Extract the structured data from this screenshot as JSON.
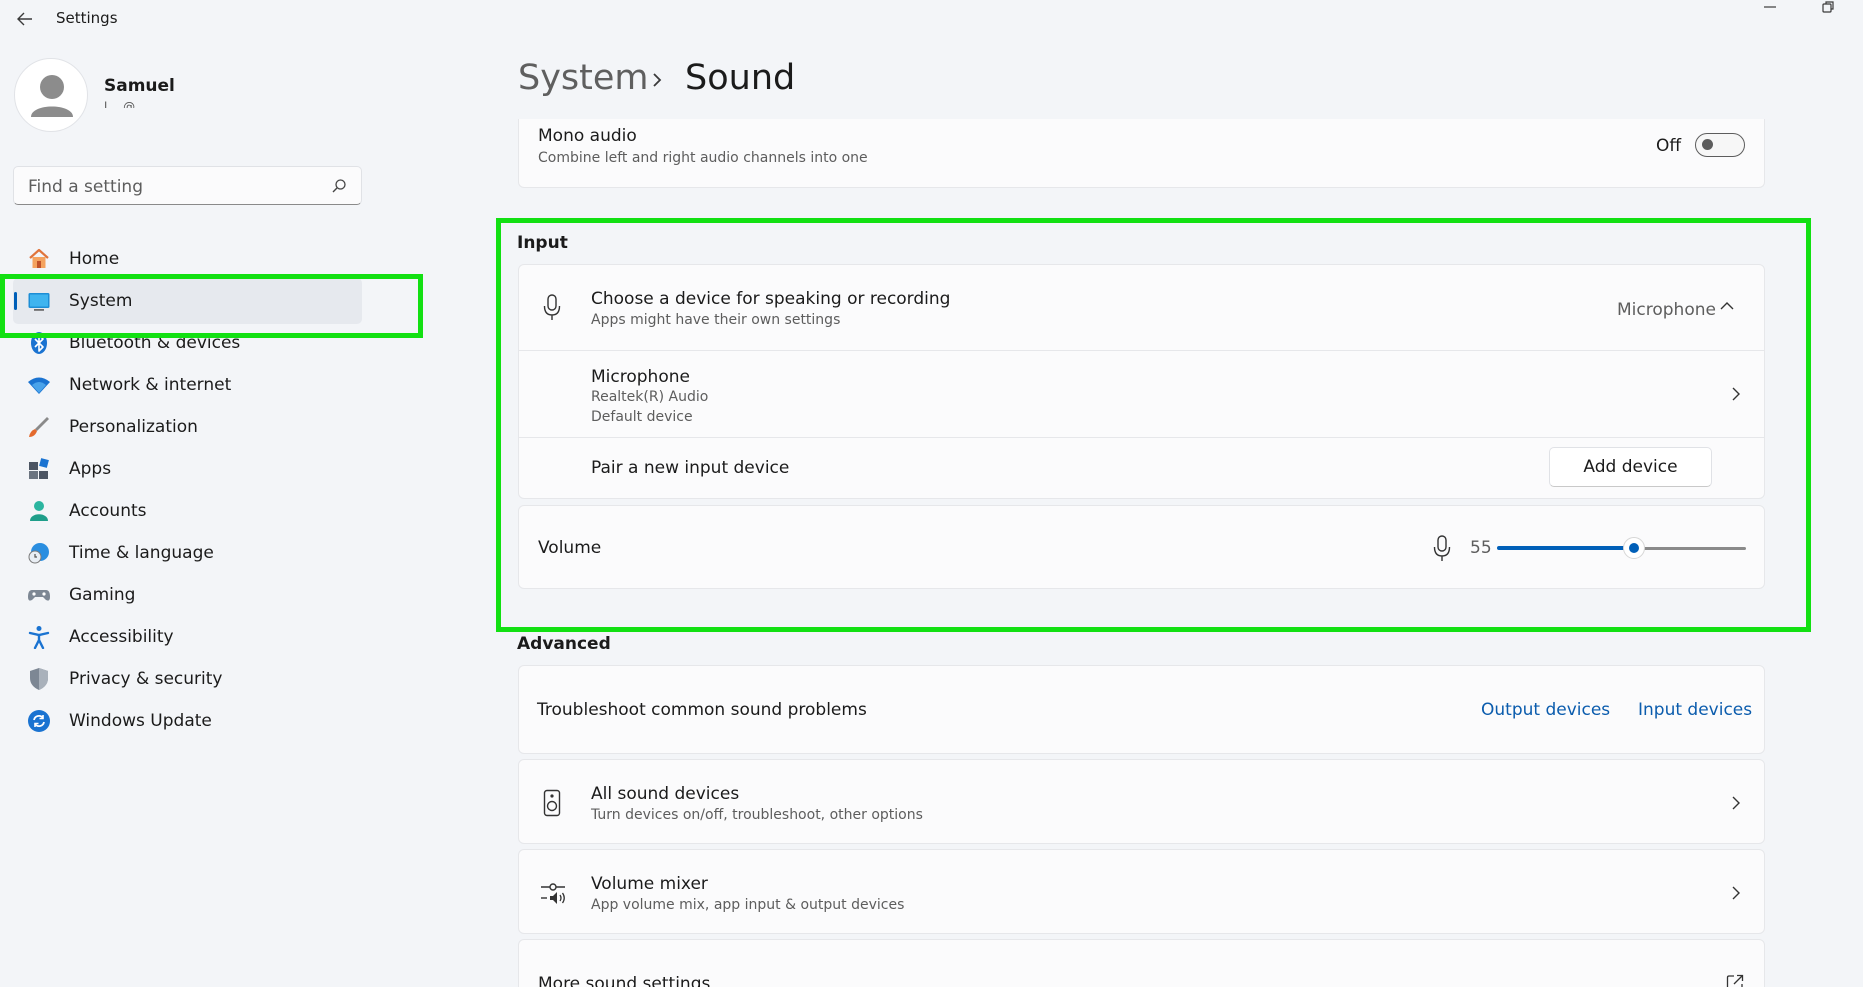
{
  "window": {
    "title": "Settings",
    "back_icon": "arrow-left-icon",
    "minimize_icon": "minimize-icon",
    "restore_icon": "restore-icon"
  },
  "profile": {
    "name": "Samuel",
    "email": "l… @…"
  },
  "search": {
    "placeholder": "Find a setting",
    "icon": "search-icon"
  },
  "sidebar": {
    "items": [
      {
        "label": "Home",
        "icon": "home-icon"
      },
      {
        "label": "System",
        "icon": "system-display-icon",
        "active": true
      },
      {
        "label": "Bluetooth & devices",
        "icon": "bluetooth-icon"
      },
      {
        "label": "Network & internet",
        "icon": "wifi-icon"
      },
      {
        "label": "Personalization",
        "icon": "paintbrush-icon"
      },
      {
        "label": "Apps",
        "icon": "apps-icon"
      },
      {
        "label": "Accounts",
        "icon": "accounts-icon"
      },
      {
        "label": "Time & language",
        "icon": "globe-clock-icon"
      },
      {
        "label": "Gaming",
        "icon": "gamepad-icon"
      },
      {
        "label": "Accessibility",
        "icon": "accessibility-icon"
      },
      {
        "label": "Privacy & security",
        "icon": "shield-icon"
      },
      {
        "label": "Windows Update",
        "icon": "windows-update-icon"
      }
    ]
  },
  "breadcrumb": {
    "parent": "System",
    "current": "Sound"
  },
  "mono_audio": {
    "title": "Mono audio",
    "description": "Combine left and right audio channels into one",
    "state_label": "Off",
    "on": false
  },
  "input": {
    "section_title": "Input",
    "choose_device": {
      "title": "Choose a device for speaking or recording",
      "description": "Apps might have their own settings",
      "selected": "Microphone",
      "icon": "microphone-icon"
    },
    "microphone": {
      "title": "Microphone",
      "line1": "Realtek(R) Audio",
      "line2": "Default device"
    },
    "pair": {
      "title": "Pair a new input device",
      "button": "Add device"
    },
    "volume": {
      "title": "Volume",
      "value": "55",
      "level": 0.55,
      "icon": "microphone-icon"
    }
  },
  "advanced": {
    "section_title": "Advanced",
    "troubleshoot": {
      "title": "Troubleshoot common sound problems",
      "link_output": "Output devices",
      "link_input": "Input devices"
    },
    "all_devices": {
      "title": "All sound devices",
      "description": "Turn devices on/off, troubleshoot, other options",
      "icon": "speaker-icon"
    },
    "mixer": {
      "title": "Volume mixer",
      "description": "App volume mix, app input & output devices",
      "icon": "volume-mixer-icon"
    },
    "more": {
      "title": "More sound settings",
      "icon": "open-external-icon"
    }
  },
  "colors": {
    "accent": "#005fb8",
    "highlight": "#12e012",
    "link": "#0b5cad"
  }
}
